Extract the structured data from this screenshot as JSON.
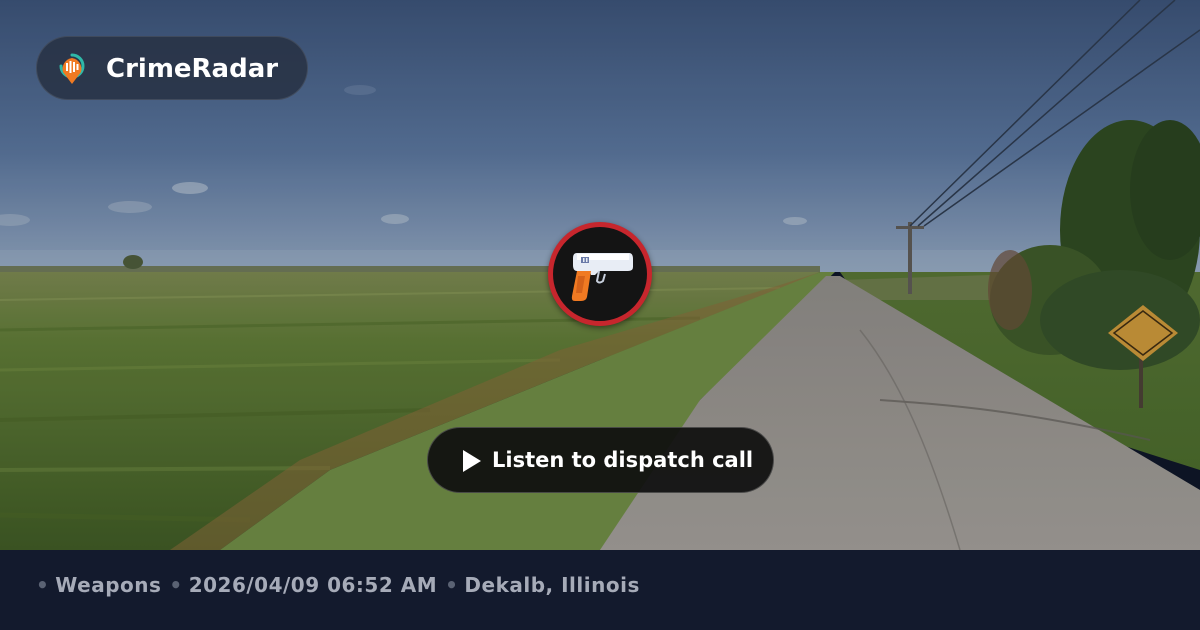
{
  "brand": {
    "name": "CrimeRadar",
    "logo_icon": "radar-pin-icon",
    "logo_colors": {
      "pin": "#f07a22",
      "ring": "#2fb9a8",
      "bars": "#ffffff"
    }
  },
  "incident_marker": {
    "icon": "handgun-icon",
    "ring_color": "#c7262d"
  },
  "listen_button": {
    "icon": "play-icon",
    "label": "Listen to dispatch call"
  },
  "footer": {
    "separator": "•",
    "category": "Weapons",
    "datetime": "2026/04/09 06:52 AM",
    "location": "Dekalb, Illinois"
  }
}
